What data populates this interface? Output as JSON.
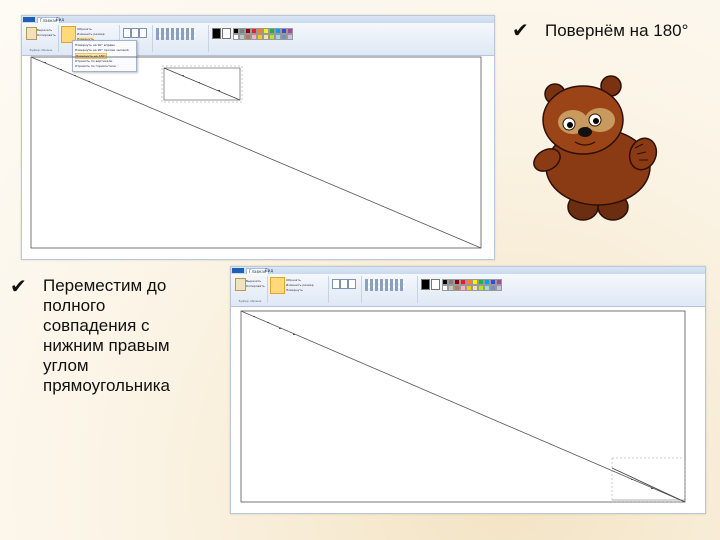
{
  "slide": {
    "caption_top": "Повернём на 180°",
    "caption_bottom": "Переместим до полного совпадения с нижним правым углом прямоугольника",
    "bullet_glyph": "✔"
  },
  "paint_app": {
    "tabs": [
      "Главная",
      "Вид"
    ],
    "ribbon_groups": [
      "Буфер обмена",
      "Изображение",
      "Инструменты",
      "Фигуры",
      "Цвета"
    ],
    "clipboard_buttons": [
      "Вставить",
      "Вырезать",
      "Копировать"
    ],
    "select_button": "Выделить",
    "image_buttons": [
      "Обрезать",
      "Изменить размер",
      "Повернуть"
    ],
    "palette_colors": [
      "#000000",
      "#7f7f7f",
      "#880015",
      "#ed1c24",
      "#ff7f27",
      "#fff200",
      "#22b14c",
      "#00a2e8",
      "#3f48cc",
      "#a349a4",
      "#ffffff",
      "#c3c3c3",
      "#b97a57",
      "#ffaec9",
      "#ffc90e",
      "#efe4b0",
      "#b5e61d",
      "#99d9ea",
      "#7092be",
      "#c8bfe7"
    ],
    "rotate_menu_items": [
      "Повернуть на 90° вправо",
      "Повернуть на 90° против часовой",
      "Повернуть на 180°",
      "Отразить по вертикали",
      "Отразить по горизонтали"
    ]
  },
  "icons": {
    "bullet": "check-icon",
    "character": "winnie-the-pooh-icon"
  }
}
